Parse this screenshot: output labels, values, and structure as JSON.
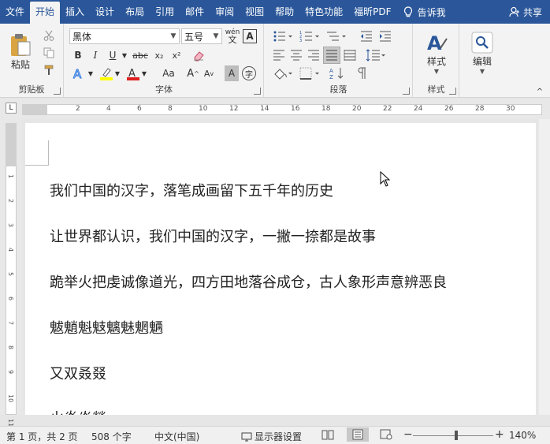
{
  "tabs": [
    "文件",
    "开始",
    "插入",
    "设计",
    "布局",
    "引用",
    "邮件",
    "审阅",
    "视图",
    "帮助",
    "特色功能",
    "福昕PDF"
  ],
  "tell_me": "告诉我",
  "share": "共享",
  "ribbon": {
    "clipboard": {
      "label": "剪贴板",
      "paste": "粘贴"
    },
    "font": {
      "label": "字体",
      "font_name": "黑体",
      "font_size": "五号",
      "bold": "B",
      "italic": "I",
      "underline": "U",
      "strike": "abc",
      "subscript": "x₂",
      "superscript": "x²",
      "grow": "A",
      "shrink": "A",
      "case": "Aa",
      "shade": "A",
      "char_border": "字",
      "wen": "wén"
    },
    "paragraph": {
      "label": "段落"
    },
    "styles": {
      "label": "样式",
      "button": "样式"
    },
    "editing": {
      "button": "编辑"
    }
  },
  "ruler": {
    "h_ticks": [
      "2",
      "4",
      "6",
      "8",
      "10",
      "12",
      "14",
      "16",
      "18",
      "20",
      "22",
      "24",
      "26",
      "28",
      "30"
    ],
    "v_ticks": [
      "1",
      "2",
      "3",
      "4",
      "5",
      "6",
      "7",
      "8",
      "9",
      "10",
      "11"
    ]
  },
  "document": {
    "lines": [
      "我们中国的汉字，落笔成画留下五千年的历史",
      "让世界都认识，我们中国的汉字，一撇一捺都是故事",
      "跪举火把虔诚像道光，四方田地落谷成仓，古人象形声意辨恶良",
      "魃魈魁鬾魑魅魍魉",
      "又双叒叕",
      "火炎焱燚"
    ]
  },
  "statusbar": {
    "page": "第 1 页，共 2 页",
    "words": "508 个字",
    "lang": "中文(中国)",
    "display": "显示器设置",
    "zoom": "140%",
    "zoom_minus": "−",
    "zoom_plus": "+"
  }
}
